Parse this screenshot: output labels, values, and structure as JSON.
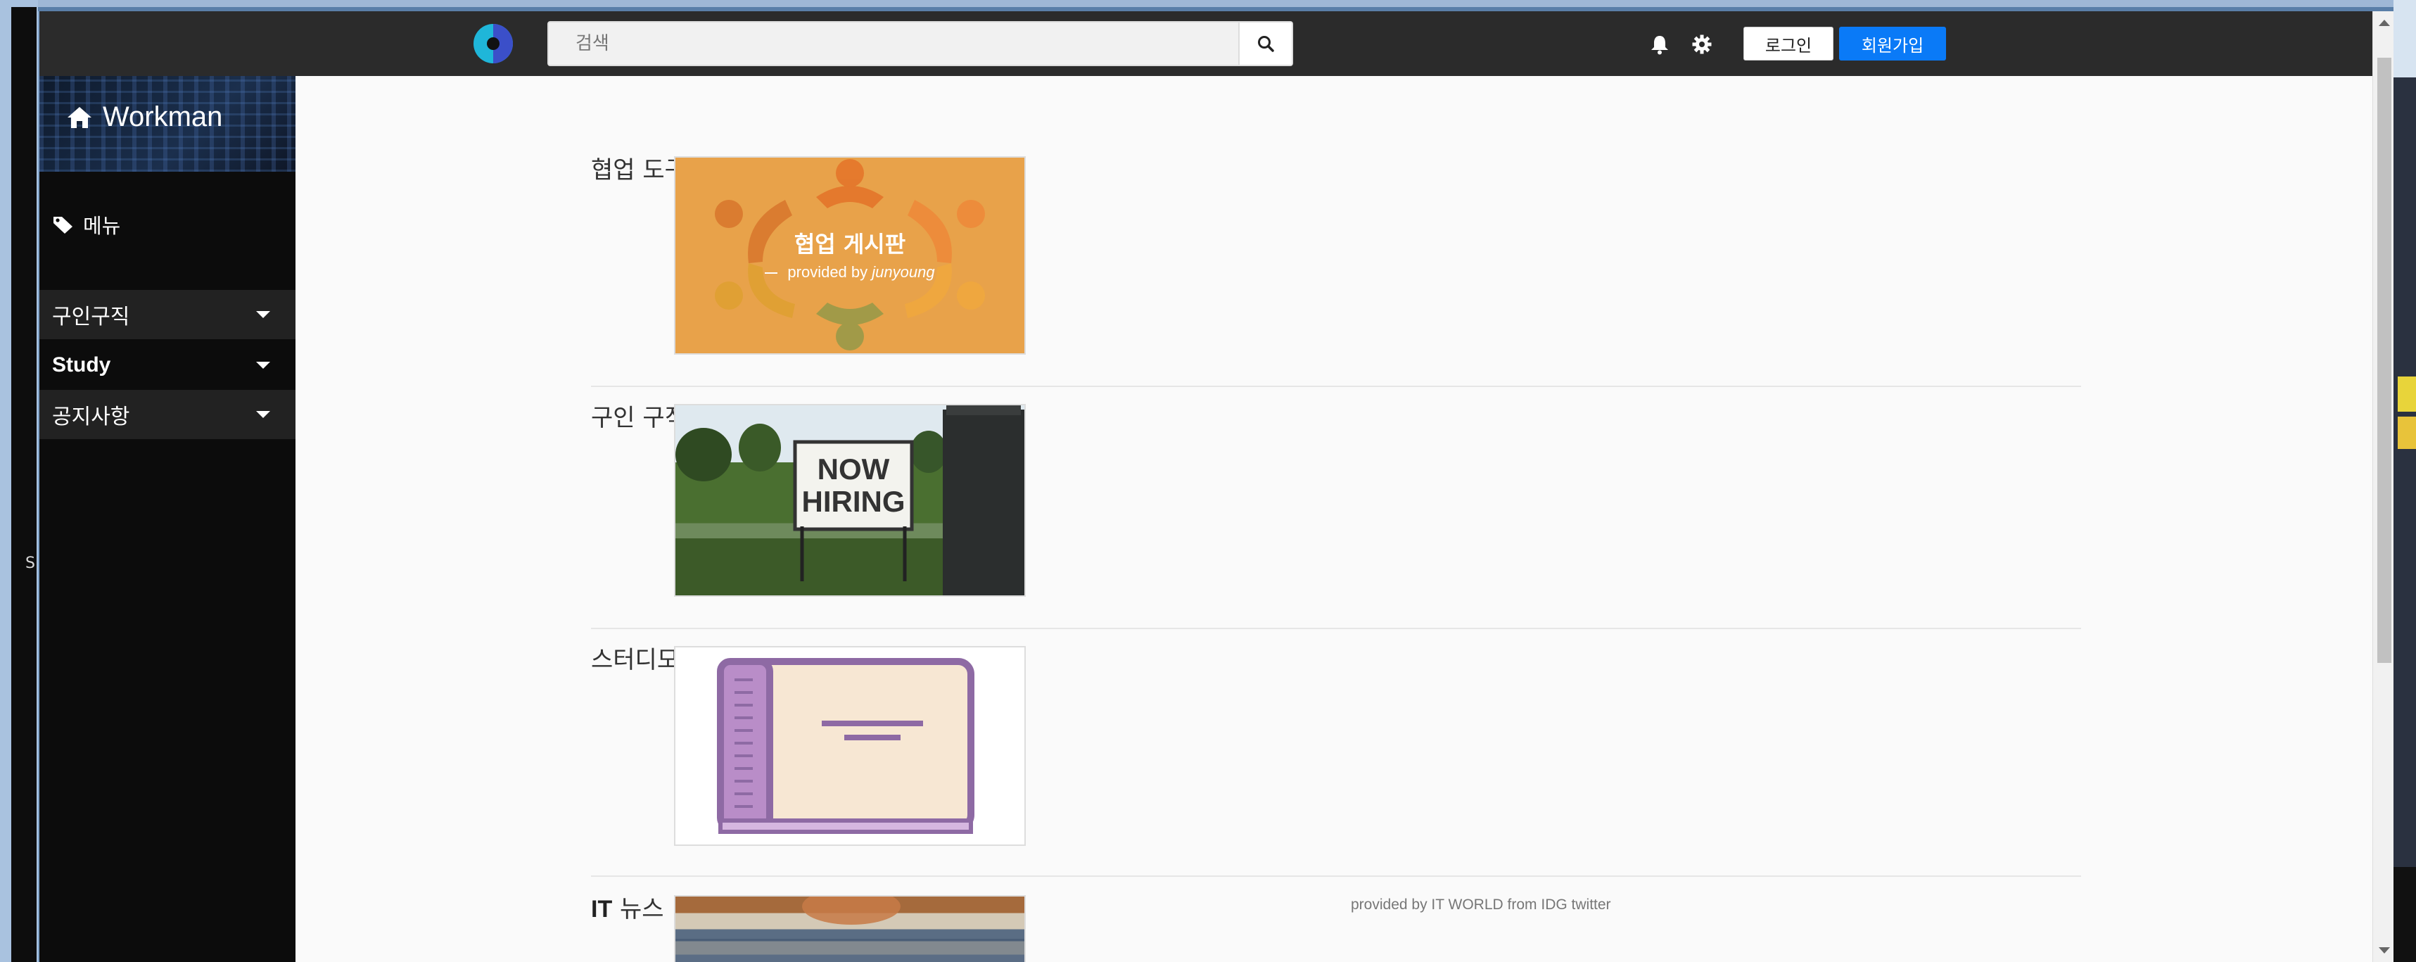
{
  "navbar": {
    "search_placeholder": "검색",
    "login_label": "로그인",
    "signup_label": "회원가입"
  },
  "sidebar": {
    "brand": "Workman",
    "menu_label": "메뉴",
    "items": [
      {
        "label": "구인구직"
      },
      {
        "label": "Study"
      },
      {
        "label": "공지사항"
      }
    ]
  },
  "sections": [
    {
      "title": "협업 도구",
      "thumb_title": "협업 게시판",
      "thumb_sub_prefix": "provided by ",
      "thumb_sub_author": "junyoung"
    },
    {
      "title": "구인 구직",
      "sign_line1": "NOW",
      "sign_line2": "HIRING"
    },
    {
      "title": "스터디모임"
    },
    {
      "title_bold": "IT",
      "title_rest": " 뉴스",
      "credit": "provided by IT WORLD from IDG twitter"
    }
  ],
  "colors": {
    "navbar_bg": "#2b2b2b",
    "signup_bg": "#0a7af7",
    "sidebar_bg": "#0c0c0c",
    "collab_bg": "#e8a24a"
  },
  "desktop": {
    "edge_text": "S"
  }
}
